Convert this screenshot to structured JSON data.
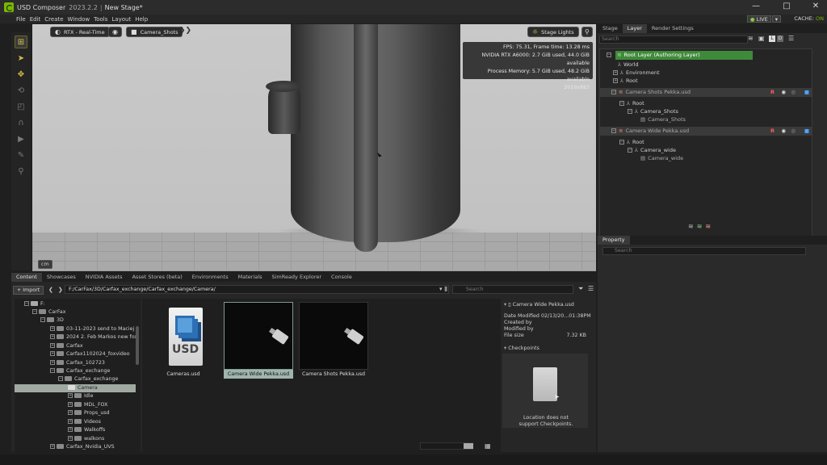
{
  "window": {
    "app": "USD Composer",
    "version": "2023.2.2",
    "stage": "New Stage*",
    "minimize": "—",
    "maximize": "□",
    "close": "✕"
  },
  "menu": [
    "File",
    "Edit",
    "Create",
    "Window",
    "Tools",
    "Layout",
    "Help"
  ],
  "live": {
    "label": "LIVE",
    "cache_label": "CACHE:",
    "cache_state": "ON"
  },
  "viewport": {
    "renderer": "RTX - Real-Time",
    "camera": "Camera_Shots",
    "stage_lights": "Stage Lights",
    "stats": [
      "FPS: 75.31, Frame time: 13.28 ms",
      "NVIDIA RTX A6000: 2.7 GiB used, 44.0 GiB available",
      "Process Memory: 5.7 GiB used, 48.2 GiB available",
      "2019x883"
    ],
    "units": "cm"
  },
  "right_tabs": [
    "Stage",
    "Layer",
    "Render Settings"
  ],
  "right_active_tab": "Layer",
  "layer": {
    "search_placeholder": "Search",
    "rows": [
      {
        "label": "Root Layer (Authoring Layer)",
        "type": "root"
      },
      {
        "label": "World"
      },
      {
        "label": "Environment"
      },
      {
        "label": "Root"
      },
      {
        "label": "Camera Shots Pekka.usd",
        "type": "sublayer",
        "flag": "R"
      },
      {
        "label": "Root"
      },
      {
        "label": "Camera_Shots"
      },
      {
        "label": "Camera_Shots"
      },
      {
        "label": "Camera Wide Pekka.usd",
        "type": "sublayer",
        "flag": "R"
      },
      {
        "label": "Root"
      },
      {
        "label": "Camera_wide"
      },
      {
        "label": "Camera_wide"
      }
    ]
  },
  "property": {
    "tab": "Property",
    "search_placeholder": "Search"
  },
  "bottom_tabs": [
    "Content",
    "Showcases",
    "NVIDIA Assets",
    "Asset Stores (beta)",
    "Environments",
    "Materials",
    "SimReady Explorer",
    "Console"
  ],
  "content": {
    "import_label": "Import",
    "path": "F:/CarFax/3D/Carfax_exchange/Carfax_exchange/Camera/",
    "search_placeholder": "Search",
    "folders": [
      "F:",
      "CarFax",
      "3D",
      "03-11-2023 send to Maciej",
      "2024 2. Feb Markos new fox",
      "Carfax",
      "Carfax1102024_foxvideo",
      "Carfax_102723",
      "Carfax_exchange",
      "Carfax_exchange",
      "Camera",
      "Idle",
      "MDL_FOX",
      "Props_usd",
      "Videos",
      "Walkoffs",
      "walkons",
      "Carfax_Nvidia_UVS"
    ],
    "files": [
      "Cameras.usd",
      "Camera Wide Pekka.usd",
      "Camera Shots Pekka.usd"
    ],
    "usd_icon_text": "USD"
  },
  "details": {
    "filename": "Camera Wide Pekka.usd",
    "date_modified_label": "Date Modified",
    "date_modified": "02/13/20...01:38PM",
    "created_by_label": "Created by",
    "modified_by_label": "Modified by",
    "file_size_label": "File size",
    "file_size": "7.32 KB",
    "checkpoints_label": "Checkpoints",
    "checkpoints_msg_1": "Location does not",
    "checkpoints_msg_2": "support Checkpoints."
  }
}
